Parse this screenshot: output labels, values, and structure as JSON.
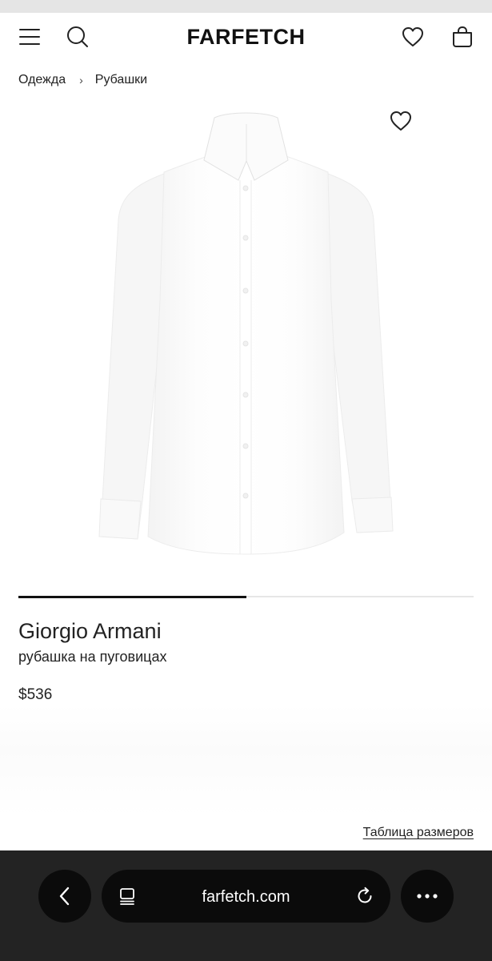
{
  "header": {
    "logo": "FARFETCH",
    "icons": [
      "menu-icon",
      "search-icon",
      "heart-icon",
      "shopping-bag-icon"
    ]
  },
  "breadcrumb": {
    "items": [
      "Одежда",
      "Рубашки"
    ],
    "separator": "›"
  },
  "product": {
    "brand": "Giorgio Armani",
    "description": "рубашка на пуговицах",
    "price": "$536",
    "image": "white-dress-shirt",
    "gallery_progress": 0.5
  },
  "size_chart": {
    "label": "Таблица размеров"
  },
  "browser": {
    "url": "farfetch.com",
    "icons": [
      "back-icon",
      "tabs-icon",
      "reload-icon",
      "more-icon"
    ]
  },
  "colors": {
    "text": "#222222",
    "accent": "#111111",
    "browser_bar": "#232323",
    "browser_button": "#0b0b0b"
  }
}
